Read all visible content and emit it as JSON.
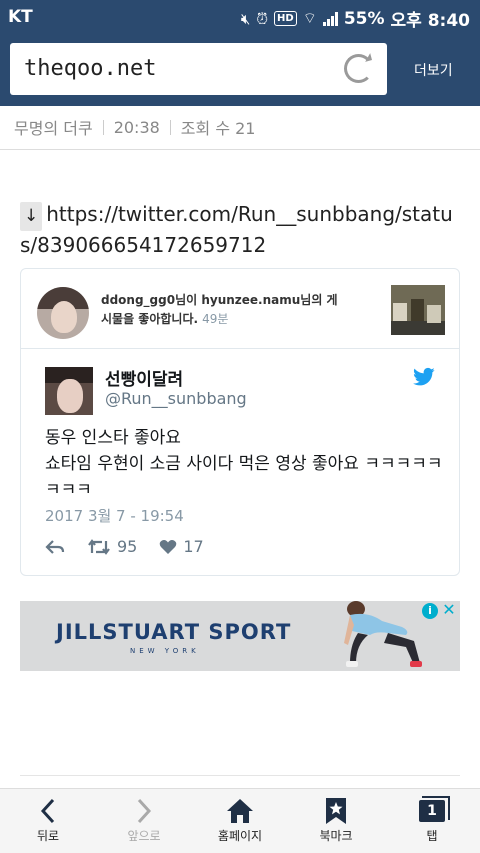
{
  "status_bar": {
    "carrier": "KT",
    "battery": "55%",
    "time": "오후 8:40",
    "hd_label": "HD"
  },
  "browser": {
    "url": "theqoo.net",
    "more_label": "더보기"
  },
  "post_meta": {
    "author": "무명의 더쿠",
    "time": "20:38",
    "views": "조회 수 21"
  },
  "post": {
    "arrow": "↓",
    "link": "https://twitter.com/Run__sunbbang/status/839066654172659712"
  },
  "tweet_embed": {
    "context": "ddong_gg0님이 hyunzee.namu님의 게시물을 좋아합니다.",
    "context_time": "49분",
    "display_name": "선빵이달려",
    "handle": "@Run__sunbbang",
    "text": "동우 인스타 좋아요\n쇼타임 우현이 소금 사이다 먹은 영상 좋아요 ㅋㅋㅋㅋㅋㅋㅋㅋ",
    "date": "2017 3월 7 - 19:54",
    "retweets": "95",
    "likes": "17",
    "colors": {
      "twitter_blue": "#1da1f2",
      "muted": "#8899a6"
    }
  },
  "ad": {
    "brand": "JILLSTUART SPORT",
    "sub": "NEW YORK",
    "info_label": "i",
    "close_label": "✕"
  },
  "nav": {
    "back": "뒤로",
    "forward": "앞으로",
    "home": "홈페이지",
    "bookmarks": "북마크",
    "tabs": "탭",
    "tab_count": "1"
  },
  "colors": {
    "header_bg": "#2b4a6f"
  }
}
